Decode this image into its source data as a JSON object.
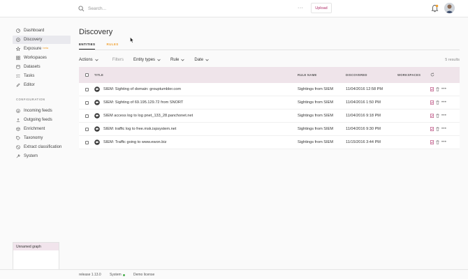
{
  "topbar": {
    "search_placeholder": "Search...",
    "more": "···",
    "upload": "Upload",
    "accent": "#b0306a"
  },
  "sidebar": {
    "items": [
      {
        "label": "Dashboard",
        "icon": "dashboard-icon"
      },
      {
        "label": "Discovery",
        "icon": "compass-icon",
        "active": true
      },
      {
        "label": "Exposure",
        "icon": "star-icon",
        "badge": "beta"
      },
      {
        "label": "Workspaces",
        "icon": "grid-icon"
      },
      {
        "label": "Datasets",
        "icon": "database-icon"
      },
      {
        "label": "Tasks",
        "icon": "checklist-icon"
      },
      {
        "label": "Editor",
        "icon": "pencil-icon"
      }
    ],
    "config_title": "CONFIGURATION",
    "config_items": [
      {
        "label": "Incoming feeds",
        "icon": "download-icon"
      },
      {
        "label": "Outgoing feeds",
        "icon": "upload-icon"
      },
      {
        "label": "Enrichment",
        "icon": "cube-icon"
      },
      {
        "label": "Taxonomy",
        "icon": "tag-icon"
      },
      {
        "label": "Extract classification",
        "icon": "block-icon"
      },
      {
        "label": "System",
        "icon": "wrench-icon"
      }
    ]
  },
  "graph_widget": {
    "title": "Unnamed graph"
  },
  "main": {
    "title": "Discovery",
    "tabs": [
      "ENTITIES",
      "RULES"
    ],
    "filters": {
      "actions": "Actions",
      "filters_label": "Filters",
      "entity_types": "Entity types",
      "rule": "Rule",
      "date": "Date",
      "results": "5 results"
    },
    "table": {
      "headers": {
        "title": "TITLE",
        "rule_name": "RULE NAME",
        "discovered": "DISCOVERED",
        "workspaces": "WORKSPACES"
      },
      "rows": [
        {
          "title": "SIEM: Sighting of domain: grouptumbler.com",
          "rule": "Sightings from SIEM",
          "discovered": "11/04/2016 12:58 PM"
        },
        {
          "title": "SIEM: Sighting of 69.195.129.72 from SNORT",
          "rule": "Sightings from SIEM",
          "discovered": "11/04/2016 1:50 PM"
        },
        {
          "title": "SIEM access log to log pnet_133_28.panchonet.net",
          "rule": "Sightings from SIEM",
          "discovered": "11/04/2016 9:18 PM"
        },
        {
          "title": "SIEM: traffic log to free.msk.ispsystem.net",
          "rule": "Sightings from SIEM",
          "discovered": "11/04/2016 9:30 PM"
        },
        {
          "title": "SIEM: Traffic going to www.ewon.biz",
          "rule": "Sightings from SIEM",
          "discovered": "11/15/2016 3:44 PM"
        }
      ]
    }
  },
  "footer": {
    "release": "release 1.13.0",
    "system": "System",
    "license": "Demo license"
  }
}
